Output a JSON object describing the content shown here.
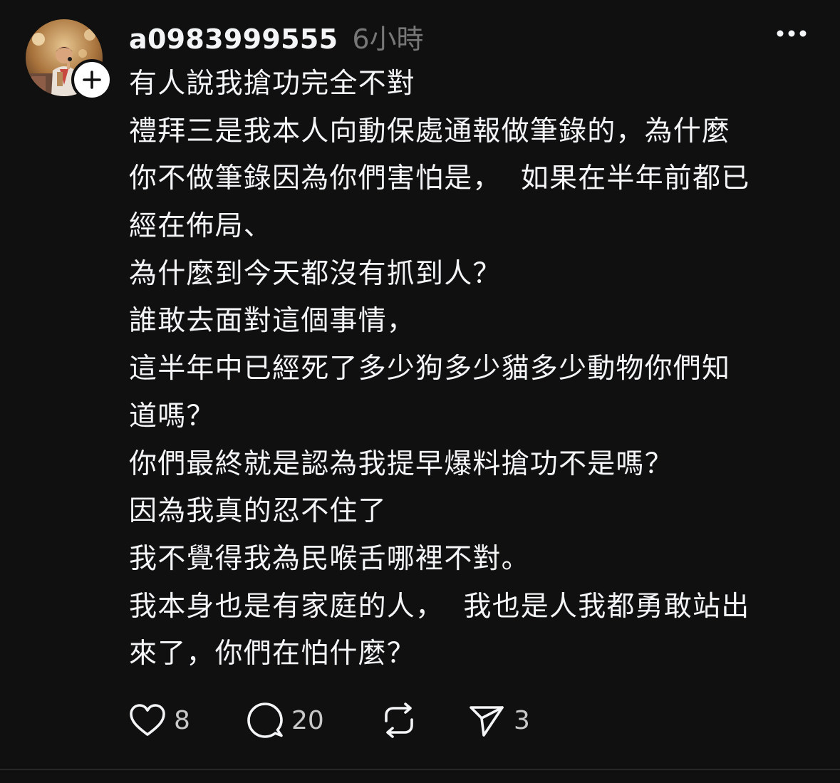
{
  "post": {
    "username": "a0983999555",
    "timestamp": "6小時",
    "body_lines": [
      "有人說我搶功完全不對",
      "禮拜三是我本人向動保處通報做筆錄的，為什麼",
      "你不做筆錄因為你們害怕是，  如果在半年前都已",
      "經在佈局、",
      "為什麼到今天都沒有抓到人？",
      "誰敢去面對這個事情，",
      "這半年中已經死了多少狗多少貓多少動物你們知",
      "道嗎？",
      "你們最終就是認為我提早爆料搶功不是嗎？",
      "因為我真的忍不住了",
      "我不覺得我為民喉舌哪裡不對。",
      "我本身也是有家庭的人，  我也是人我都勇敢站出",
      "來了，你們在怕什麼？"
    ],
    "stats": {
      "likes": "8",
      "replies": "20",
      "shares": "3"
    }
  },
  "icons": {
    "follow": "plus-icon",
    "more": "more-horizontal-icon",
    "like": "heart-icon",
    "reply": "speech-bubble-icon",
    "repost": "repost-icon",
    "share": "send-icon"
  },
  "colors": {
    "background": "#101010",
    "text_primary": "#f3f5f7",
    "text_secondary": "#777777",
    "count_text": "#c9c9c9",
    "divider": "#262626"
  }
}
